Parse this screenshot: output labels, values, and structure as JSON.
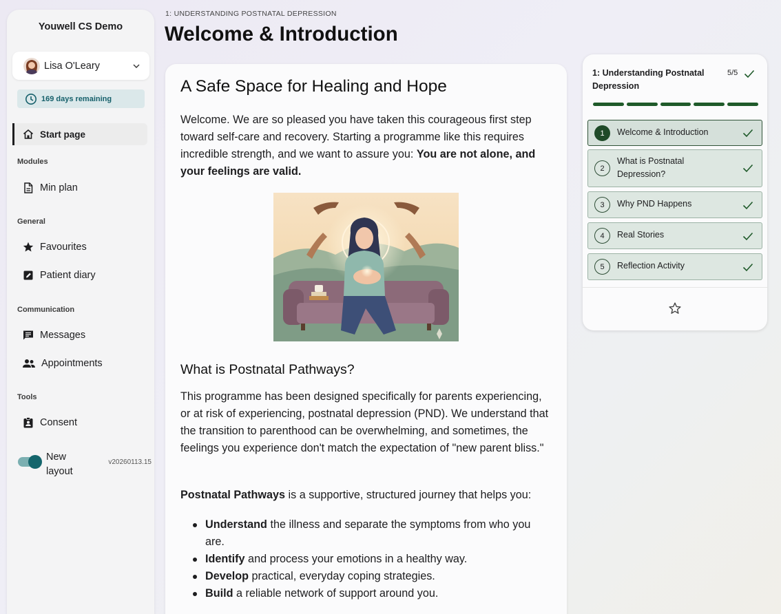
{
  "sidebar": {
    "app_title": "Youwell CS Demo",
    "user": {
      "name": "Lisa O'Leary",
      "avatar_icon": "avatar-photo",
      "dropdown_icon": "chevron-down-icon"
    },
    "days_remaining": "169 days remaining",
    "start_page": "Start page",
    "sections": {
      "modules": "Modules",
      "general": "General",
      "communication": "Communication",
      "tools": "Tools"
    },
    "items": {
      "min_plan": "Min plan",
      "favourites": "Favourites",
      "patient_diary": "Patient diary",
      "messages": "Messages",
      "appointments": "Appointments",
      "consent": "Consent"
    },
    "toggle": {
      "label": "New layout",
      "on": true
    },
    "version": "v20260113.15"
  },
  "header": {
    "breadcrumb": "1: UNDERSTANDING POSTNATAL DEPRESSION",
    "title": "Welcome & Introduction"
  },
  "content": {
    "heading": "A Safe Space for Healing and Hope",
    "intro_text": "Welcome. We are so pleased you have taken this courageous first step toward self-care and recovery. Starting a programme like this requires incredible strength, and we want to assure you: ",
    "intro_bold": "You are not alone, and your feelings are valid.",
    "section_heading": "What is Postnatal Pathways?",
    "about_text": "This programme has been designed specifically for parents experiencing, or at risk of experiencing, postnatal depression (PND). We understand that the transition to parenthood can be overwhelming, and sometimes, the feelings you experience don't match the expectation of \"new parent bliss.\"",
    "journey_bold": "Postnatal Pathways",
    "journey_text": " is a supportive, structured journey that helps you:",
    "bullets": [
      {
        "bold": "Understand",
        "text": " the illness and separate the symptoms from who you are."
      },
      {
        "bold": "Identify",
        "text": " and process your emotions in a healthy way."
      },
      {
        "bold": "Develop",
        "text": " practical, everyday coping strategies."
      },
      {
        "bold": "Build",
        "text": " a reliable network of support around you."
      }
    ]
  },
  "module_panel": {
    "title": "1: Understanding Postnatal Depression",
    "progress": "5/5",
    "completed": 5,
    "total": 5,
    "lessons": [
      {
        "number": "1",
        "label": "Welcome & Introduction",
        "done": true,
        "current": true
      },
      {
        "number": "2",
        "label": "What is Postnatal Depression?",
        "done": true,
        "current": false
      },
      {
        "number": "3",
        "label": "Why PND Happens",
        "done": true,
        "current": false
      },
      {
        "number": "4",
        "label": "Real Stories",
        "done": true,
        "current": false
      },
      {
        "number": "5",
        "label": "Reflection Activity",
        "done": true,
        "current": false
      }
    ],
    "favourite_icon": "star-outline-icon"
  },
  "colors": {
    "accent_teal": "#14656c",
    "complete_green": "#1f5a2a",
    "badge_bg": "#dbe8ea"
  }
}
